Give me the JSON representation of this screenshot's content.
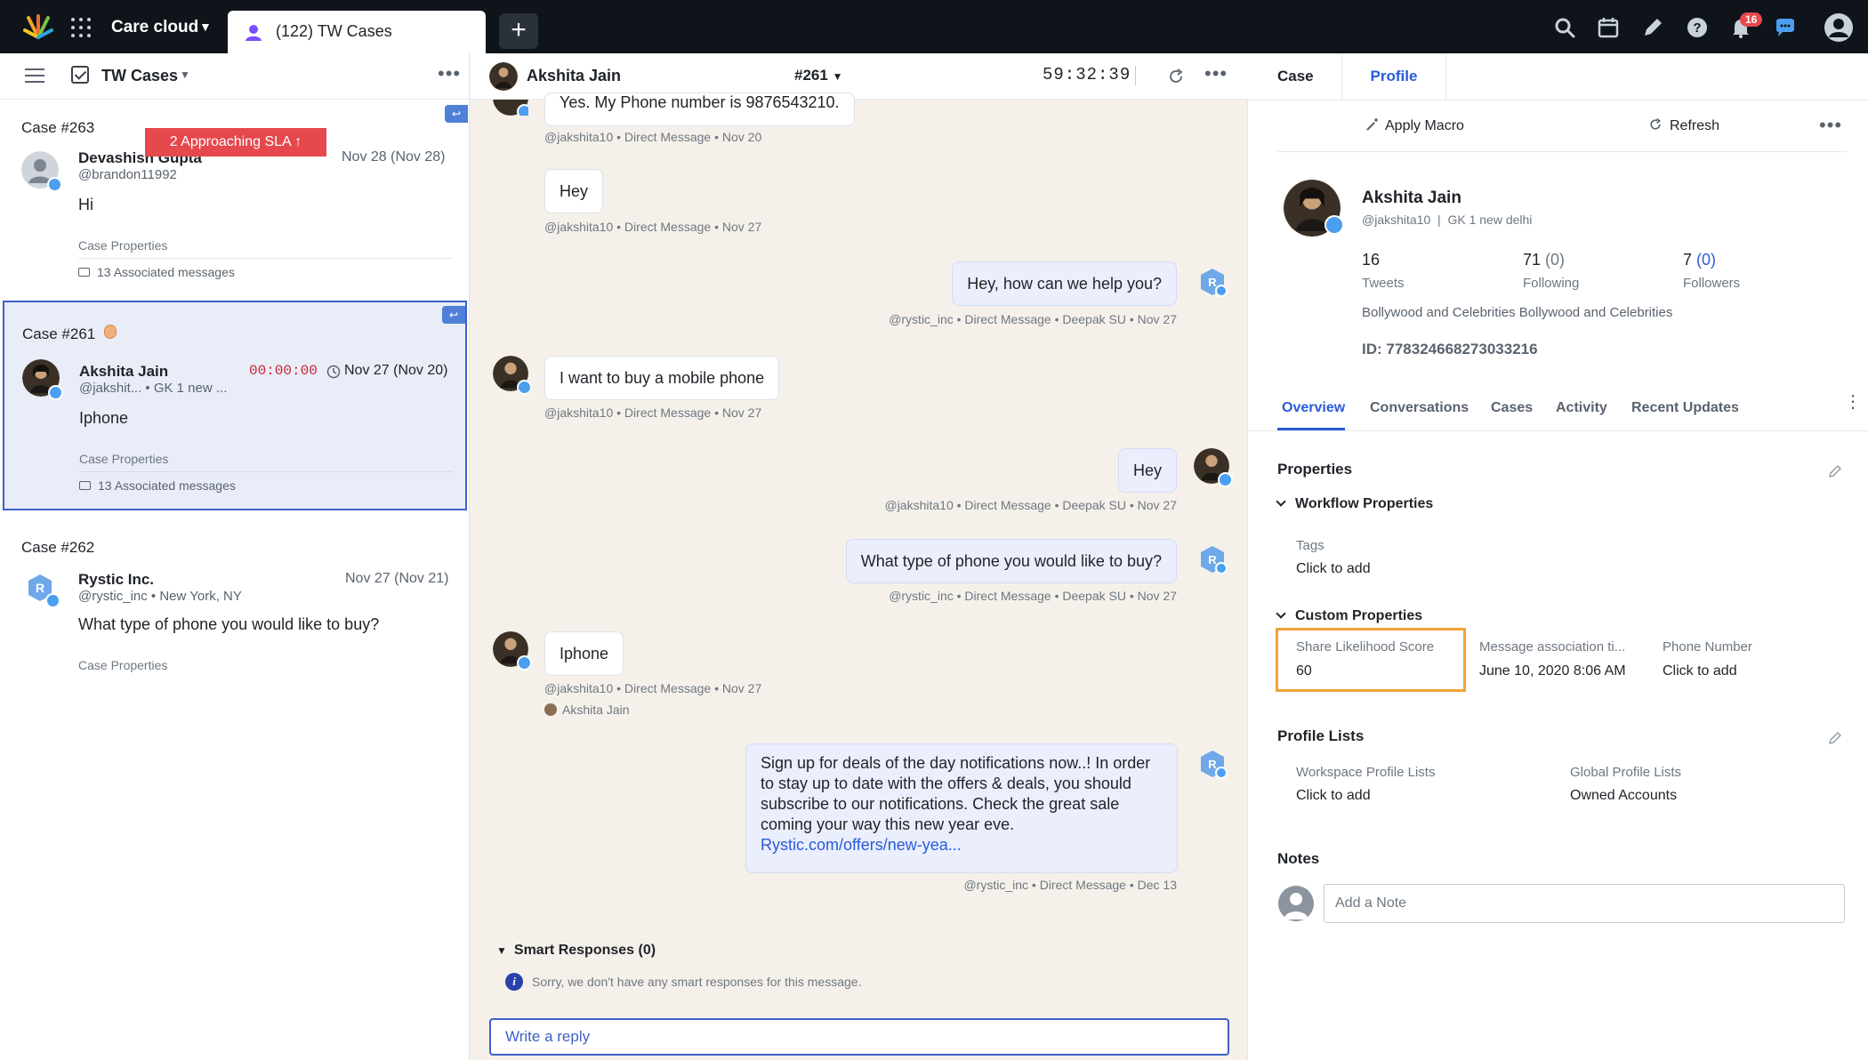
{
  "topbar": {
    "app_name": "Care cloud",
    "active_tab": "(122) TW Cases",
    "add_tab": "+",
    "notification_count": "16",
    "icons": [
      "search-icon",
      "calendar-icon",
      "pencil-icon",
      "help-icon",
      "bell-icon",
      "chat-icon",
      "account-icon"
    ]
  },
  "left_panel": {
    "title": "TW Cases",
    "cases": [
      {
        "case_num": "Case #263",
        "name": "Devashish Gupta",
        "handle": "@brandon11992",
        "date": "Nov 28 (Nov 28)",
        "preview": "Hi",
        "props": "Case Properties",
        "assoc": "13 Associated messages",
        "sla": "2 Approaching SLA ↑"
      },
      {
        "case_num": "Case #261",
        "name": "Akshita Jain",
        "handle": "@jakshit... • GK 1 new ...",
        "timer": "00:00:00",
        "date": "Nov 27 (Nov 20)",
        "preview": "Iphone",
        "props": "Case Properties",
        "assoc": "13 Associated messages"
      },
      {
        "case_num": "Case #262",
        "name": "Rystic Inc.",
        "handle": "@rystic_inc • New York, NY",
        "date": "Nov 27 (Nov 21)",
        "preview": "What type of phone you would like to buy?",
        "props": "Case Properties"
      }
    ]
  },
  "conversation": {
    "title": "Akshita Jain",
    "case_id": "#261",
    "timer": "59:32:39",
    "messages": [
      {
        "text": "Yes. My Phone number is 9876543210.",
        "meta": "@jakshita10 • Direct Message • Nov 20"
      },
      {
        "text": "Hey",
        "meta": "@jakshita10 • Direct Message • Nov 27"
      },
      {
        "text": "Hey, how can we help you?",
        "meta": "@rystic_inc • Direct Message • Deepak SU • Nov 27"
      },
      {
        "text": "I want to buy a mobile phone",
        "meta": "@jakshita10 • Direct Message • Nov 27"
      },
      {
        "text": "Hey",
        "meta": "@jakshita10 • Direct Message • Deepak SU • Nov 27"
      },
      {
        "text": "What type of phone you would like to buy?",
        "meta": "@rystic_inc • Direct Message • Deepak SU • Nov 27"
      },
      {
        "text": "Iphone",
        "meta": "@jakshita10 • Direct Message • Nov 27",
        "sub": "Akshita Jain"
      },
      {
        "text": "Sign up for deals of the day notifications now..! In order to stay up to date with the offers & deals, you should subscribe to our notifications. Check the great sale coming your way this new year eve.",
        "link": "Rystic.com/offers/new-yea...",
        "meta": "@rystic_inc • Direct Message • Dec 13"
      }
    ],
    "smart_responses": "Smart Responses (0)",
    "smart_note": "Sorry, we don't have any smart responses for this message.",
    "reply_placeholder": "Write a reply"
  },
  "profile_panel": {
    "tabs": [
      "Case",
      "Profile"
    ],
    "apply_macro": "Apply Macro",
    "refresh": "Refresh",
    "name": "Akshita Jain",
    "sub": "@jakshita10  |  GK 1 new delhi",
    "tweets": "16",
    "tweets_label": "Tweets",
    "following": "71",
    "following_paren": "(0)",
    "following_label": "Following",
    "followers": "7",
    "followers_paren": "(0)",
    "followers_label": "Followers",
    "bio": "Bollywood and Celebrities Bollywood and Celebrities",
    "id": "ID: 778324668273033216",
    "subtabs": [
      "Overview",
      "Conversations",
      "Cases",
      "Activity",
      "Recent Updates"
    ],
    "properties_title": "Properties",
    "workflow_title": "Workflow Properties",
    "tags_label": "Tags",
    "tags_value": "Click to add",
    "custom_title": "Custom Properties",
    "custom_fields": [
      {
        "label": "Share Likelihood Score",
        "value": "60"
      },
      {
        "label": "Message association ti...",
        "value": "June 10, 2020 8:06 AM"
      },
      {
        "label": "Phone Number",
        "value": "Click to add"
      }
    ],
    "profile_lists_title": "Profile Lists",
    "workspace_lists_label": "Workspace Profile Lists",
    "workspace_lists_value": "Click to add",
    "global_lists_label": "Global Profile Lists",
    "global_lists_value": "Owned Accounts",
    "notes_title": "Notes",
    "note_placeholder": "Add a Note"
  }
}
